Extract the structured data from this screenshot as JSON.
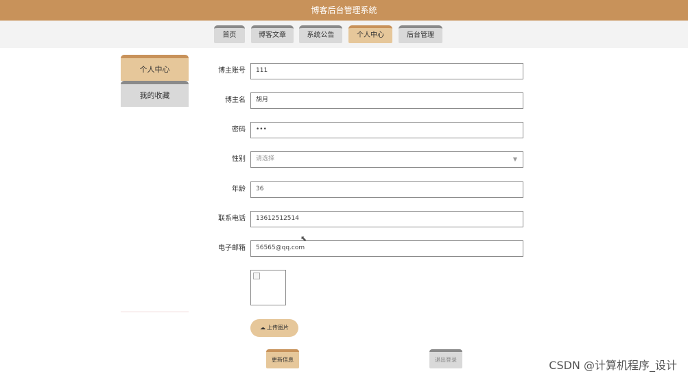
{
  "app": {
    "title": "博客后台管理系统"
  },
  "nav": {
    "tabs": [
      {
        "label": "首页"
      },
      {
        "label": "博客文章"
      },
      {
        "label": "系统公告"
      },
      {
        "label": "个人中心",
        "active": true
      },
      {
        "label": "后台管理"
      }
    ]
  },
  "sidebar": {
    "items": [
      {
        "label": "个人中心",
        "active": true
      },
      {
        "label": "我的收藏"
      }
    ]
  },
  "form": {
    "account": {
      "label": "博主账号",
      "value": "111"
    },
    "name": {
      "label": "博主名",
      "value": "胡月"
    },
    "password": {
      "label": "密码",
      "value": "•••"
    },
    "gender": {
      "label": "性别",
      "placeholder": "请选择"
    },
    "age": {
      "label": "年龄",
      "value": "36"
    },
    "phone": {
      "label": "联系电话",
      "value": "13612512514"
    },
    "email": {
      "label": "电子邮箱",
      "value": "56565@qq.com"
    }
  },
  "upload_label": "上传图片",
  "actions": {
    "update": "更新信息",
    "logout": "退出登录"
  },
  "watermark": "CSDN @计算机程序_设计",
  "colors": {
    "brand": "#c8925a",
    "brand_light": "#e6c79a",
    "tab_grey": "#d9d9d9",
    "tab_grey_border": "#8a8a8a"
  }
}
